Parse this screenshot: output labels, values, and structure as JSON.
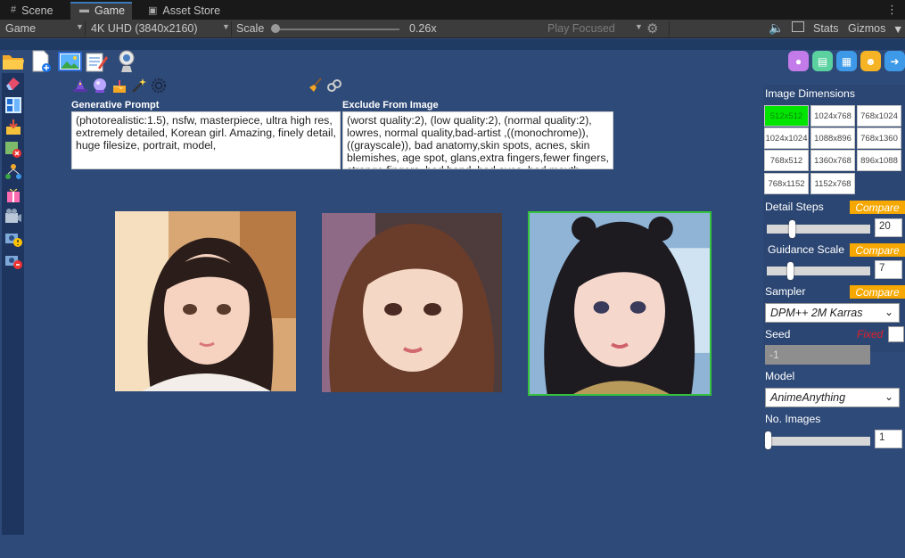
{
  "tabs": [
    {
      "icon": "scene-grid-icon",
      "label": "Scene"
    },
    {
      "icon": "gamepad-icon",
      "label": "Game"
    },
    {
      "icon": "store-bag-icon",
      "label": "Asset Store"
    }
  ],
  "toolbar": {
    "display": "Game",
    "resolution": "4K UHD (3840x2160)",
    "scale_label": "Scale",
    "scale_value": "0.26x",
    "play_mode": "Play Focused",
    "stats_label": "Stats",
    "gizmos_label": "Gizmos"
  },
  "prompt": {
    "positive_label": "Generative Prompt",
    "positive_text": "(photorealistic:1.5), nsfw, masterpiece, ultra high res, extremely detailed, Korean girl. Amazing, finely detail, huge filesize, portrait, model,",
    "negative_label": "Exclude From Image",
    "negative_text": "(worst quality:2), (low quality:2), (normal quality:2), lowres, normal quality,bad-artist ,((monochrome)), ((grayscale)),          bad anatomy,skin spots, acnes, skin blemishes, age spot, glans,extra fingers,fewer fingers, strange fingers, bad hand, bad eyes, bad mouth"
  },
  "images": [
    {
      "name": "generated-image-1",
      "selected": false
    },
    {
      "name": "generated-image-2",
      "selected": false
    },
    {
      "name": "generated-image-3",
      "selected": true
    }
  ],
  "panel": {
    "image_dimensions_label": "Image Dimensions",
    "dimensions": [
      "512x512",
      "1024x768",
      "768x1024",
      "1024x1024",
      "1088x896",
      "768x1360",
      "768x512",
      "1360x768",
      "896x1088",
      "768x1152",
      "1152x768"
    ],
    "active_dimension": "512x512",
    "detail_steps_label": "Detail Steps",
    "detail_steps_value": "20",
    "guidance_scale_label": "Guidance Scale",
    "guidance_scale_value": "7",
    "compare_label": "Compare",
    "sampler_label": "Sampler",
    "sampler_value": "DPM++ 2M  Karras",
    "seed_label": "Seed",
    "seed_fixed_label": "Fixed",
    "seed_value": "-1",
    "model_label": "Model",
    "model_value": "AnimeAnything",
    "num_images_label": "No. Images",
    "num_images_value": "1"
  },
  "colors": {
    "background": "#2e4a78",
    "active_dimension": "#00e500",
    "compare": "#f6a800",
    "selected_border": "#35c33d",
    "fixed_text": "#e4202a"
  }
}
